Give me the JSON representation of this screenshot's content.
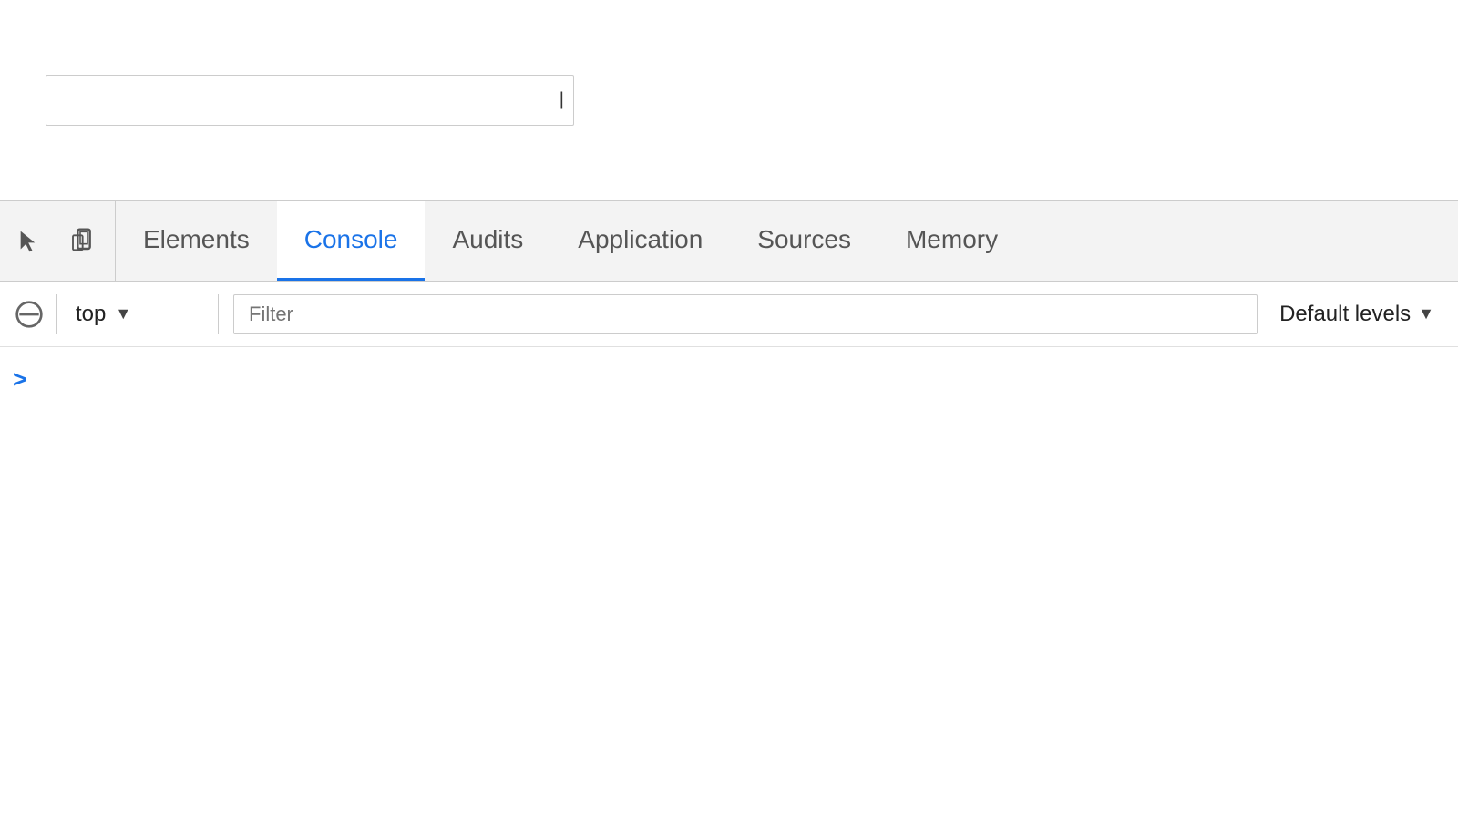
{
  "top_area": {
    "url_bar_placeholder": "",
    "url_bar_value": ""
  },
  "devtools": {
    "tabs": [
      {
        "id": "elements",
        "label": "Elements",
        "active": false
      },
      {
        "id": "console",
        "label": "Console",
        "active": true
      },
      {
        "id": "audits",
        "label": "Audits",
        "active": false
      },
      {
        "id": "application",
        "label": "Application",
        "active": false
      },
      {
        "id": "sources",
        "label": "Sources",
        "active": false
      },
      {
        "id": "memory",
        "label": "Memory",
        "active": false
      }
    ],
    "toolbar": {
      "context_label": "top",
      "filter_placeholder": "Filter",
      "levels_label": "Default levels"
    },
    "console": {
      "prompt_symbol": ">"
    }
  }
}
